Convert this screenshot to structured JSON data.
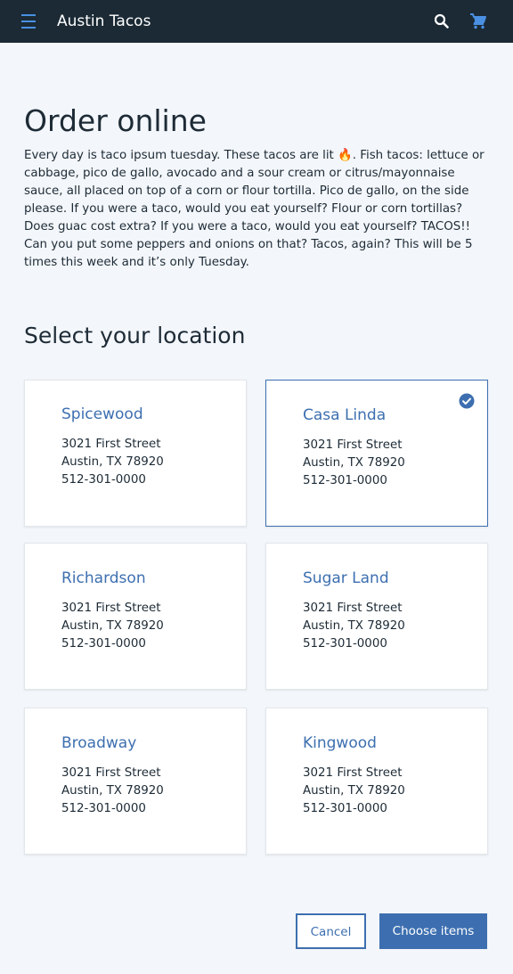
{
  "header": {
    "title": "Austin Tacos",
    "icons": [
      "menu-icon",
      "search-icon",
      "cart-icon"
    ],
    "background": "#1b2a35",
    "accent": "#4a90e2"
  },
  "main": {
    "title": "Order online",
    "intro": "Every day is taco ipsum tuesday. These tacos are lit 🔥. Fish tacos: lettuce or cabbage, pico de gallo, avocado and a sour cream or citrus/mayonnaise sauce, all placed on top of a corn or flour tortilla. Pico de gallo, on the side please. If you were a taco, would you eat yourself? Flour or corn tortillas? Does guac cost extra? If you were a taco, would you eat yourself? TACOS!! Can you put some peppers and onions on that? Tacos, again? This will be 5 times this week and it’s only Tuesday.",
    "section_title": "Select your location"
  },
  "locations": [
    {
      "name": "Spicewood",
      "street": "3021 First Street",
      "city": "Austin, TX 78920",
      "phone": "512-301-0000",
      "selected": false
    },
    {
      "name": "Casa Linda",
      "street": "3021 First Street",
      "city": "Austin, TX 78920",
      "phone": "512-301-0000",
      "selected": true
    },
    {
      "name": "Richardson",
      "street": "3021 First Street",
      "city": "Austin, TX 78920",
      "phone": "512-301-0000",
      "selected": false
    },
    {
      "name": "Sugar Land",
      "street": "3021 First Street",
      "city": "Austin, TX 78920",
      "phone": "512-301-0000",
      "selected": false
    },
    {
      "name": "Broadway",
      "street": "3021 First Street",
      "city": "Austin, TX 78920",
      "phone": "512-301-0000",
      "selected": false
    },
    {
      "name": "Kingwood",
      "street": "3021 First Street",
      "city": "Austin, TX 78920",
      "phone": "512-301-0000",
      "selected": false
    }
  ],
  "actions": {
    "cancel_label": "Cancel",
    "primary_label": "Choose items"
  },
  "colors": {
    "primary": "#3d6fb0",
    "page_bg": "#f3f6fa",
    "text": "#1d2b36"
  }
}
